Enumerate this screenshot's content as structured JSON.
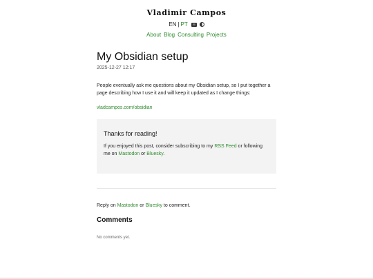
{
  "site": {
    "title": "Vladimir Campos",
    "lang_en": "EN",
    "lang_sep": "|",
    "lang_pt": "PT",
    "icons": [
      "rss-icon",
      "theme-toggle-icon"
    ]
  },
  "nav": {
    "items": [
      {
        "label": "About"
      },
      {
        "label": "Blog"
      },
      {
        "label": "Consulting"
      },
      {
        "label": "Projects"
      }
    ]
  },
  "post": {
    "title": "My Obsidian setup",
    "date": "2025-12-27 12:17",
    "body": "People eventually ask me questions about my Obsidian setup, so I put together a page describing how I use it and will keep it updated as I change things:",
    "link": "vladcampos.com/obsidian"
  },
  "thanks": {
    "title": "Thanks for reading!",
    "text_1": "If you enjoyed this post, consider subscribing to my ",
    "rss_label": "RSS Feed",
    "text_2": " or following me on ",
    "mastodon_label": "Mastodon",
    "text_3": " or ",
    "bluesky_label": "Bluesky",
    "text_4": "."
  },
  "reply": {
    "text_1": "Reply on ",
    "mastodon_label": "Mastodon",
    "text_2": " or ",
    "bluesky_label": "Bluesky",
    "text_3": " to comment."
  },
  "comments": {
    "title": "Comments",
    "empty": "No comments yet."
  },
  "colors": {
    "link": "#2e8b2e",
    "box_bg": "#f3f3f3"
  }
}
